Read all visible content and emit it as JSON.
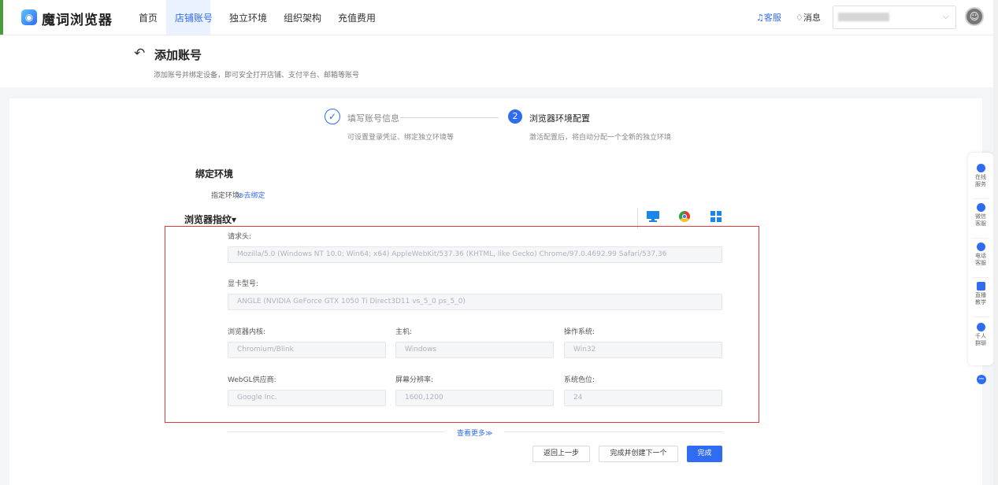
{
  "nav": {
    "logo_glyph": "◉",
    "logo_text": "魔词浏览器",
    "tabs": [
      "首页",
      "店铺账号",
      "独立环境",
      "组织架构",
      "充值费用"
    ],
    "active_tab": "店铺账号",
    "support": "♫客服",
    "messages": "♢消息",
    "account_arrow": "⌵",
    "avatar_glyph": "☺"
  },
  "header": {
    "back_glyph": "↶",
    "title": "添加账号",
    "subtitle": "添加账号并绑定设备，即可安全打开店铺、支付平台、邮箱等账号"
  },
  "steps": [
    {
      "title": "填写账号信息",
      "desc": "可设置登录凭证、绑定独立环境等",
      "state": "done",
      "glyph": "✓"
    },
    {
      "title": "浏览器环境配置",
      "desc": "激活配置后，将自动分配一个全新的独立环境",
      "state": "active",
      "glyph": "2"
    }
  ],
  "bind": {
    "section_title": "绑定环境",
    "label": "指定环境:",
    "link": "⊘去绑定"
  },
  "fingerprint": {
    "title": "浏览器指纹▾",
    "icons": [
      "monitor-icon",
      "chrome-icon",
      "windows-icon"
    ],
    "fields": {
      "user_agent": {
        "label": "请求头:",
        "value": "Mozilla/5.0 (Windows NT 10.0; Win64; x64) AppleWebKit/537.36 (KHTML, like Gecko) Chrome/97.0.4692.99 Safari/537.36"
      },
      "gpu": {
        "label": "显卡型号:",
        "value": "ANGLE (NVIDIA GeForce GTX 1050 Ti Direct3D11 vs_5_0 ps_5_0)"
      },
      "engine": {
        "label": "浏览器内核:",
        "value": "Chromium/Blink"
      },
      "host": {
        "label": "主机:",
        "value": "Windows"
      },
      "os": {
        "label": "操作系统:",
        "value": "Win32"
      },
      "webgl_vendor": {
        "label": "WebGL供应商:",
        "value": "Google Inc."
      },
      "resolution": {
        "label": "屏幕分辨率:",
        "value": "1600,1200"
      },
      "color_depth": {
        "label": "系统色位:",
        "value": "24"
      }
    },
    "highlight_color": "#e03a3a"
  },
  "more": "查看更多≫",
  "buttons": {
    "back": "返回上一步",
    "finish_next": "完成并创建下一个",
    "finish": "完成"
  },
  "float_bar": [
    {
      "name": "online-service",
      "lines": [
        "在线",
        "服务"
      ]
    },
    {
      "name": "wechat-service",
      "lines": [
        "微信",
        "客服"
      ]
    },
    {
      "name": "phone-service",
      "lines": [
        "电话",
        "客服"
      ]
    },
    {
      "name": "live-teaching",
      "lines": [
        "直播",
        "教学"
      ]
    },
    {
      "name": "qian-ren-group",
      "lines": [
        "千人",
        "群聊"
      ]
    }
  ],
  "float_minus": "−",
  "colors": {
    "primary": "#2f6cf1",
    "nav_active_bg": "#eaf1ff",
    "page_bg": "#f4f5f7"
  }
}
